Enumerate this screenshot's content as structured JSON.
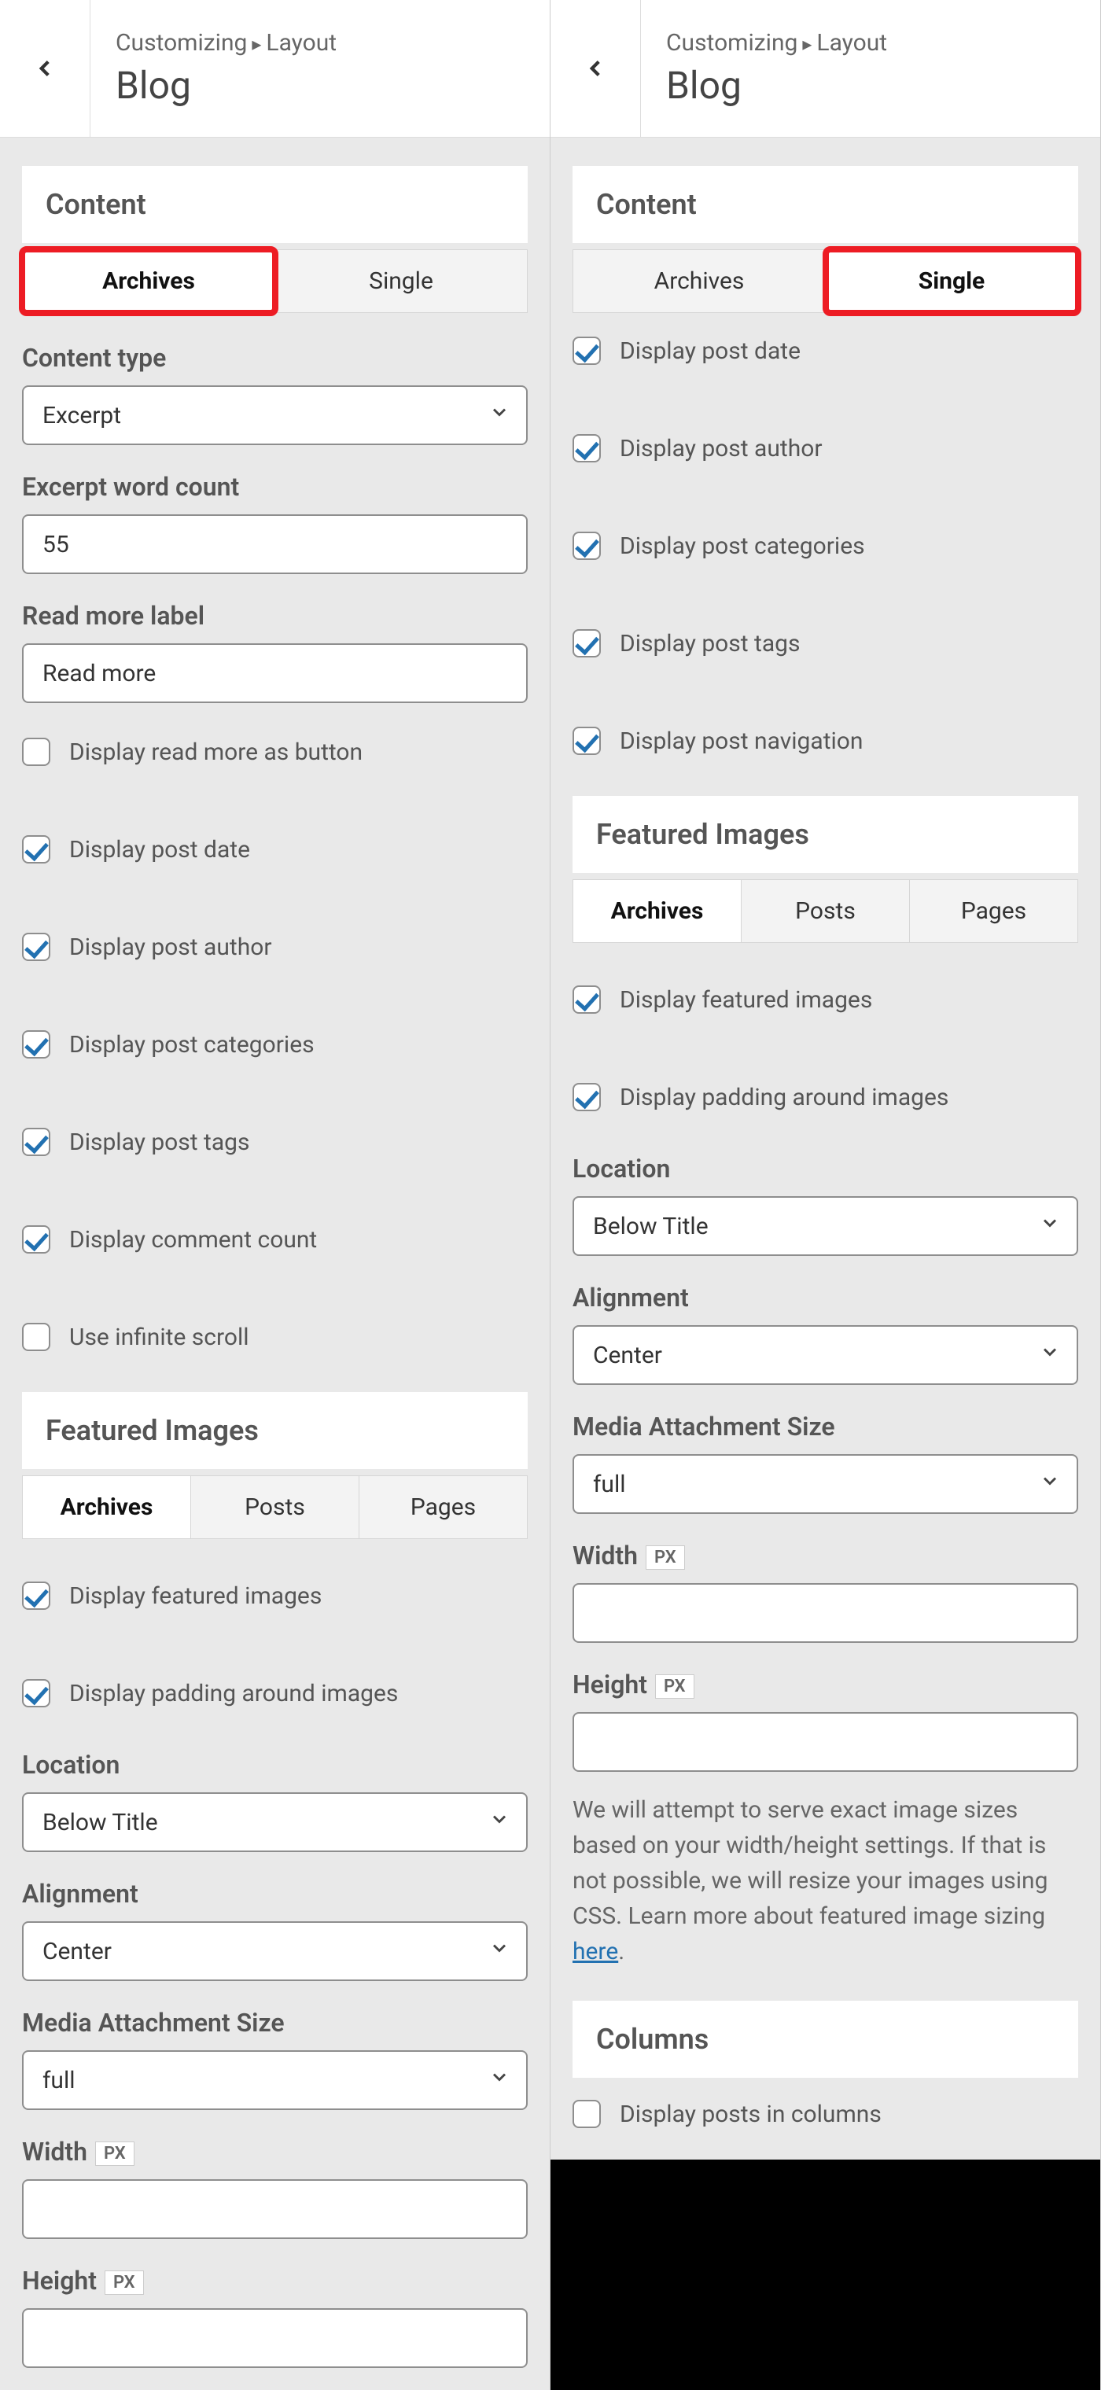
{
  "breadcrumb": {
    "a": "Customizing",
    "b": "Layout"
  },
  "title": "Blog",
  "sections": {
    "content": "Content",
    "featured": "Featured Images",
    "columns": "Columns"
  },
  "tabs": {
    "content": {
      "archives": "Archives",
      "single": "Single"
    },
    "featured": {
      "archives": "Archives",
      "posts": "Posts",
      "pages": "Pages"
    }
  },
  "labels": {
    "content_type": "Content type",
    "excerpt_word_count": "Excerpt word count",
    "read_more_label": "Read more label",
    "location": "Location",
    "alignment": "Alignment",
    "media_attachment_size": "Media Attachment Size",
    "width": "Width",
    "height": "Height",
    "px": "PX"
  },
  "values": {
    "content_type": "Excerpt",
    "excerpt_word_count": "55",
    "read_more_label": "Read more",
    "location": "Below Title",
    "alignment": "Center",
    "media_attachment_size": "full"
  },
  "checks": {
    "display_read_more_as_button": "Display read more as button",
    "display_post_date": "Display post date",
    "display_post_author": "Display post author",
    "display_post_categories": "Display post categories",
    "display_post_tags": "Display post tags",
    "display_comment_count": "Display comment count",
    "use_infinite_scroll": "Use infinite scroll",
    "display_post_navigation": "Display post navigation",
    "display_featured_images": "Display featured images",
    "display_padding_around_images": "Display padding around images",
    "display_posts_in_columns": "Display posts in columns"
  },
  "info": {
    "text": "We will attempt to serve exact image sizes based on your width/height settings. If that is not possible, we will resize your images using CSS. Learn more about featured image sizing ",
    "link": "here",
    "period": "."
  }
}
